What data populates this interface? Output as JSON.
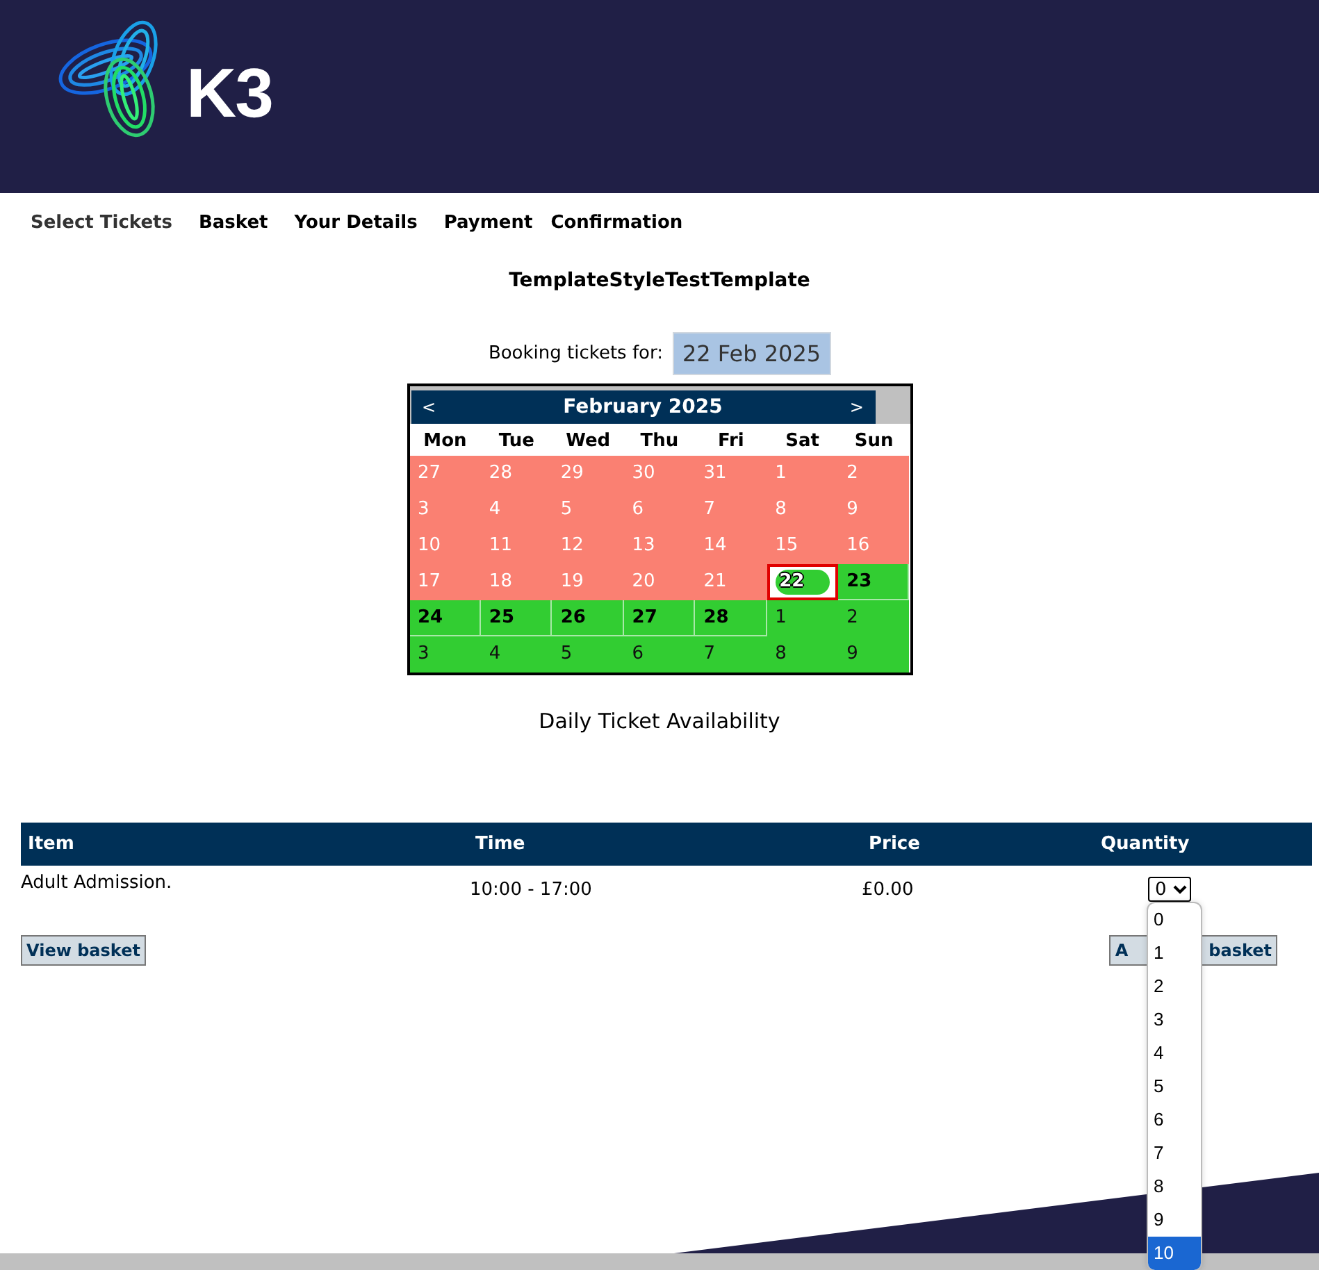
{
  "header": {
    "brand": "K3"
  },
  "steps": [
    {
      "label": "Select Tickets",
      "selected": true
    },
    {
      "label": "Basket",
      "selected": false
    },
    {
      "label": "Your Details",
      "selected": false
    },
    {
      "label": "Payment",
      "selected": false
    },
    {
      "label": "Confirmation",
      "selected": false
    }
  ],
  "title": "TemplateStyleTestTemplate",
  "booking": {
    "label": "Booking tickets for:",
    "value": "22 Feb 2025"
  },
  "calendar": {
    "month": "February 2025",
    "prev": "<",
    "next": ">",
    "weekdays": [
      "Mon",
      "Tue",
      "Wed",
      "Thu",
      "Fri",
      "Sat",
      "Sun"
    ],
    "days": [
      {
        "label": "27",
        "kind": "unavailable",
        "selected": false
      },
      {
        "label": "28",
        "kind": "unavailable",
        "selected": false
      },
      {
        "label": "29",
        "kind": "unavailable",
        "selected": false
      },
      {
        "label": "30",
        "kind": "unavailable",
        "selected": false
      },
      {
        "label": "31",
        "kind": "unavailable",
        "selected": false
      },
      {
        "label": "1",
        "kind": "unavailable",
        "selected": false
      },
      {
        "label": "2",
        "kind": "unavailable",
        "selected": false
      },
      {
        "label": "3",
        "kind": "unavailable",
        "selected": false
      },
      {
        "label": "4",
        "kind": "unavailable",
        "selected": false
      },
      {
        "label": "5",
        "kind": "unavailable",
        "selected": false
      },
      {
        "label": "6",
        "kind": "unavailable",
        "selected": false
      },
      {
        "label": "7",
        "kind": "unavailable",
        "selected": false
      },
      {
        "label": "8",
        "kind": "unavailable",
        "selected": false
      },
      {
        "label": "9",
        "kind": "unavailable",
        "selected": false
      },
      {
        "label": "10",
        "kind": "unavailable",
        "selected": false
      },
      {
        "label": "11",
        "kind": "unavailable",
        "selected": false
      },
      {
        "label": "12",
        "kind": "unavailable",
        "selected": false
      },
      {
        "label": "13",
        "kind": "unavailable",
        "selected": false
      },
      {
        "label": "14",
        "kind": "unavailable",
        "selected": false
      },
      {
        "label": "15",
        "kind": "unavailable",
        "selected": false
      },
      {
        "label": "16",
        "kind": "unavailable",
        "selected": false
      },
      {
        "label": "17",
        "kind": "unavailable",
        "selected": false
      },
      {
        "label": "18",
        "kind": "unavailable",
        "selected": false
      },
      {
        "label": "19",
        "kind": "unavailable",
        "selected": false
      },
      {
        "label": "20",
        "kind": "unavailable",
        "selected": false
      },
      {
        "label": "21",
        "kind": "unavailable",
        "selected": false
      },
      {
        "label": "22",
        "kind": "available",
        "selected": true
      },
      {
        "label": "23",
        "kind": "available",
        "selected": false
      },
      {
        "label": "24",
        "kind": "available",
        "selected": false
      },
      {
        "label": "25",
        "kind": "available",
        "selected": false
      },
      {
        "label": "26",
        "kind": "available",
        "selected": false
      },
      {
        "label": "27",
        "kind": "available",
        "selected": false
      },
      {
        "label": "28",
        "kind": "available",
        "selected": false
      },
      {
        "label": "1",
        "kind": "other",
        "selected": false
      },
      {
        "label": "2",
        "kind": "other",
        "selected": false
      },
      {
        "label": "3",
        "kind": "other",
        "selected": false
      },
      {
        "label": "4",
        "kind": "other",
        "selected": false
      },
      {
        "label": "5",
        "kind": "other",
        "selected": false
      },
      {
        "label": "6",
        "kind": "other",
        "selected": false
      },
      {
        "label": "7",
        "kind": "other",
        "selected": false
      },
      {
        "label": "8",
        "kind": "other",
        "selected": false
      },
      {
        "label": "9",
        "kind": "other",
        "selected": false
      }
    ]
  },
  "availability_label": "Daily Ticket Availability",
  "table": {
    "columns": [
      "Item",
      "Time",
      "Price",
      "Quantity"
    ],
    "rows": [
      {
        "item": "Adult Admission.",
        "time": "10:00 - 17:00",
        "price": "£0.00",
        "quantity": "0"
      }
    ]
  },
  "buttons": {
    "view_basket": "View basket",
    "add_basket_parts": [
      "A",
      "basket"
    ]
  },
  "quantity_options": [
    {
      "label": "0",
      "selected": false
    },
    {
      "label": "1",
      "selected": false
    },
    {
      "label": "2",
      "selected": false
    },
    {
      "label": "3",
      "selected": false
    },
    {
      "label": "4",
      "selected": false
    },
    {
      "label": "5",
      "selected": false
    },
    {
      "label": "6",
      "selected": false
    },
    {
      "label": "7",
      "selected": false
    },
    {
      "label": "8",
      "selected": false
    },
    {
      "label": "9",
      "selected": false
    },
    {
      "label": "10",
      "selected": true
    }
  ]
}
